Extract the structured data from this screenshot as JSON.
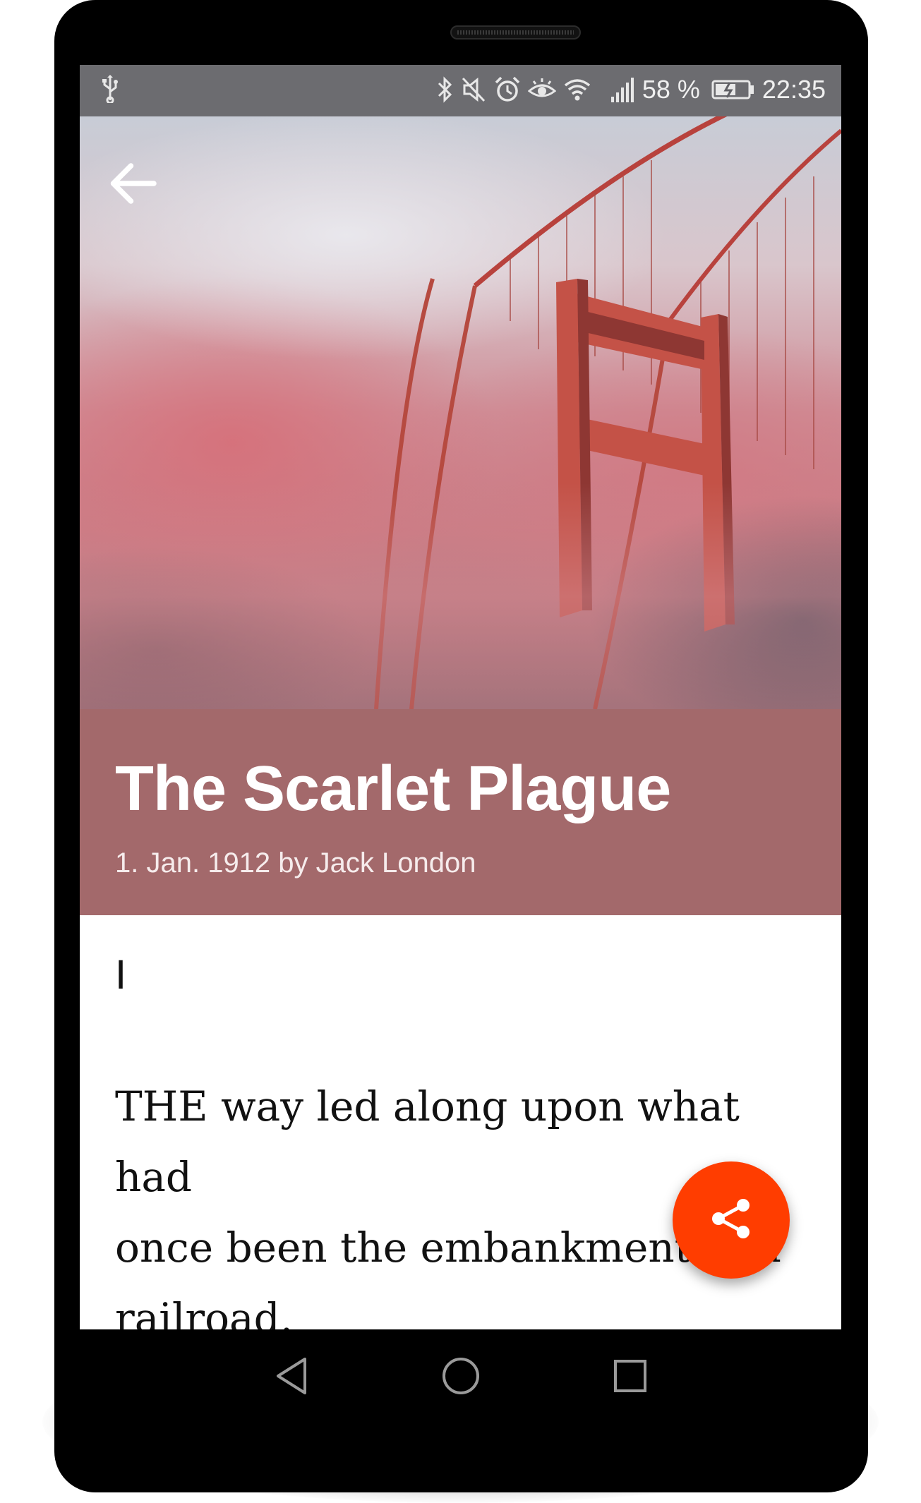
{
  "status_bar": {
    "battery_percent": "58 %",
    "time": "22:35"
  },
  "book": {
    "title": "The Scarlet Plague",
    "subtitle": "1. Jan. 1912 by Jack London"
  },
  "article": {
    "chapter": "I",
    "paragraph": "THE way led along upon what had\nonce been the embankment of a\nrailroad.\nBut no train had run upon it for"
  },
  "colors": {
    "title_band": "#a3696b",
    "fab": "#ff3d00"
  },
  "icons": {
    "back": "arrow-left-icon",
    "share": "share-icon",
    "nav_back": "triangle-back-icon",
    "nav_home": "circle-home-icon",
    "nav_recents": "square-recents-icon"
  }
}
